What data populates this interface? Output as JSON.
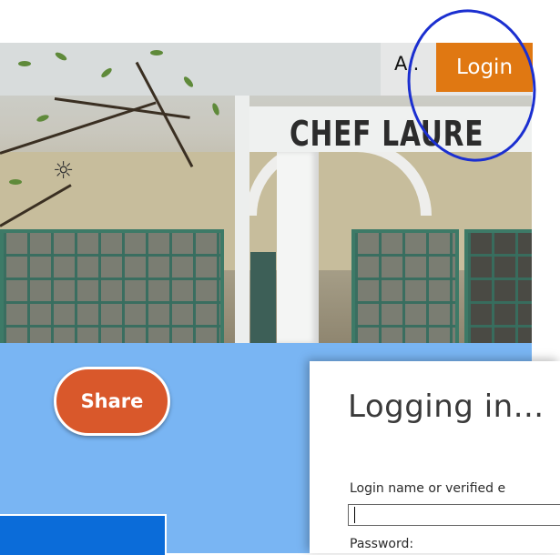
{
  "header": {
    "user_abbrev": "A..",
    "login_label": "Login"
  },
  "hero": {
    "sign_text": "CHEF LAURE"
  },
  "sidebar": {
    "share_label": "Share"
  },
  "login_dialog": {
    "title": "Logging in...",
    "username_label": "Login name or verified e",
    "username_value": "",
    "password_label": "Password:"
  },
  "colors": {
    "login_button": "#e07812",
    "share_button": "#d9582b",
    "panel_background": "#79b5f3",
    "annotation_ring": "#1b2fd0"
  }
}
